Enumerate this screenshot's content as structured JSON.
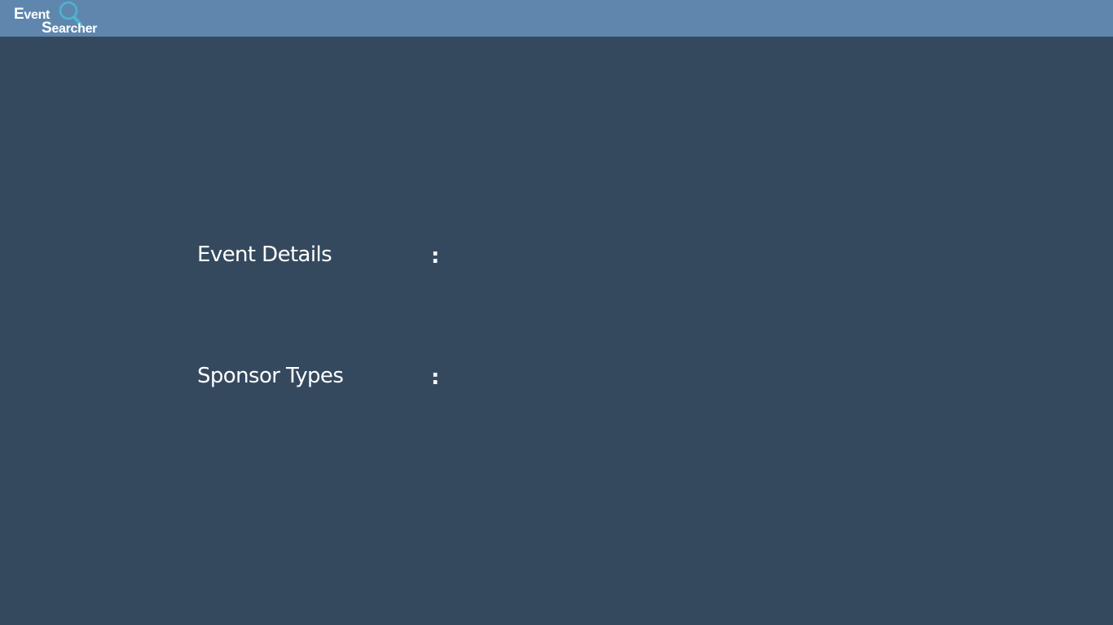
{
  "header": {
    "logo_word_1_cap": "E",
    "logo_word_1_rest": "vent",
    "logo_word_2_cap": "S",
    "logo_word_2_rest": "earcher",
    "logo_icon": "magnifier-icon",
    "colors": {
      "bar": "#5f87ae",
      "logo_text": "#ffffff",
      "icon": "#4fb3d1"
    }
  },
  "details": {
    "rows": [
      {
        "label": "Event Details",
        "separator": ":"
      },
      {
        "label": "Sponsor Types",
        "separator": ":"
      }
    ]
  },
  "theme": {
    "background": "#35495e",
    "text": "#ffffff"
  }
}
